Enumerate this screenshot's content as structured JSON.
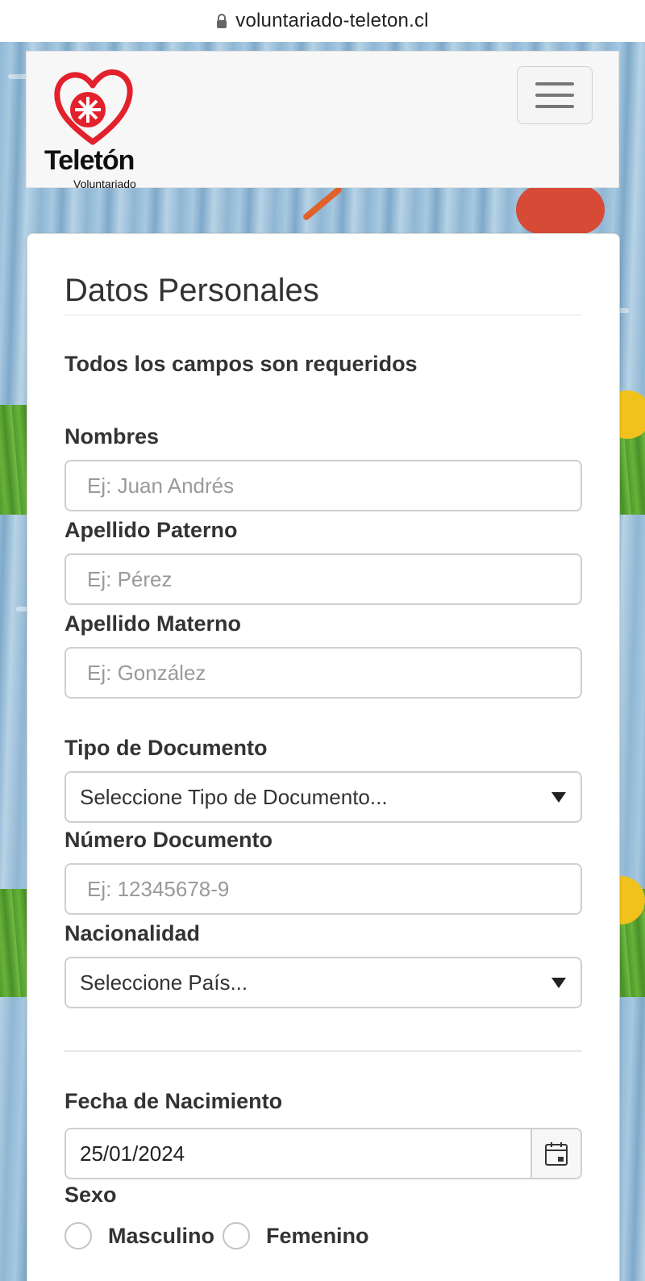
{
  "browser": {
    "url": "voluntariado-teleton.cl"
  },
  "navbar": {
    "brand": "Teletón",
    "brand_sub": "Voluntariado"
  },
  "form": {
    "title": "Datos Personales",
    "required_note": "Todos los campos son requeridos",
    "nombres": {
      "label": "Nombres",
      "placeholder": "Ej: Juan Andrés",
      "value": ""
    },
    "apellido_paterno": {
      "label": "Apellido Paterno",
      "placeholder": "Ej: Pérez",
      "value": ""
    },
    "apellido_materno": {
      "label": "Apellido Materno",
      "placeholder": "Ej: González",
      "value": ""
    },
    "tipo_documento": {
      "label": "Tipo de Documento",
      "selected": "Seleccione Tipo de Documento..."
    },
    "numero_documento": {
      "label": "Número Documento",
      "placeholder": "Ej: 12345678-9",
      "value": ""
    },
    "nacionalidad": {
      "label": "Nacionalidad",
      "selected": "Seleccione País..."
    },
    "fecha_nacimiento": {
      "label": "Fecha de Nacimiento",
      "value": "25/01/2024"
    },
    "sexo": {
      "label": "Sexo",
      "options": [
        "Masculino",
        "Femenino"
      ]
    }
  },
  "icons": {
    "lock": "lock-icon",
    "menu": "hamburger-menu-icon",
    "caret": "caret-down-icon",
    "calendar": "calendar-icon"
  },
  "colors": {
    "brand_red": "#e3212d",
    "text": "#333333",
    "border": "#cfcfcf",
    "placeholder": "#9a9a9a"
  }
}
